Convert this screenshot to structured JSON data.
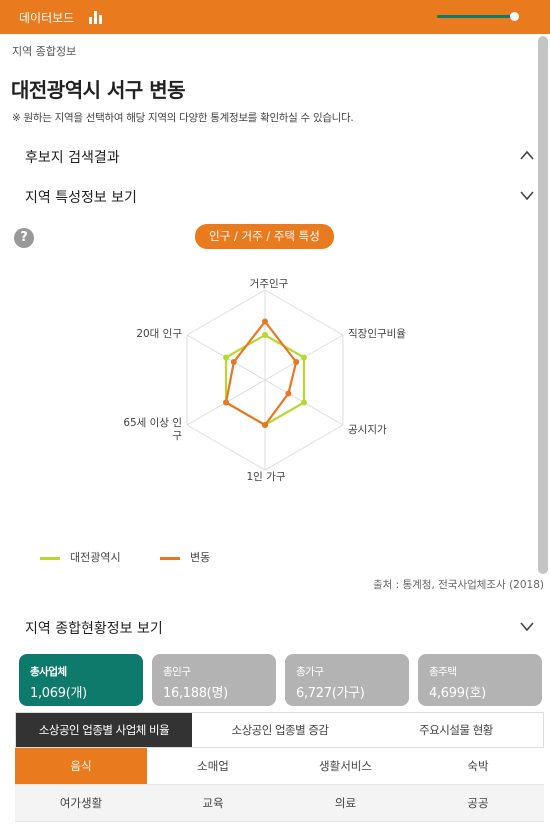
{
  "app": {
    "title": "데이터보드",
    "zoom_level": 0.9
  },
  "breadcrumb": "지역 종합정보",
  "page": {
    "title": "대전광역시 서구 변동",
    "note": "※ 원하는 지역을 선택하여 해당 지역의 다양한 통계정보를 확인하실 수 있습니다."
  },
  "sections": {
    "candidate_results": "후보지 검색결과",
    "region_features": "지역 특성정보 보기",
    "region_summary": "지역 종합현황정보 보기"
  },
  "feature_pill": "인구 / 거주 / 주택 특성",
  "help_label": "?",
  "chart_data": {
    "type": "radar",
    "axes": [
      "거주인구",
      "직장인구비율",
      "공시지가",
      "1인 가구",
      "65세 이상 인구",
      "20대 인구"
    ],
    "scale": [
      0,
      1
    ],
    "series": [
      {
        "name": "대전광역시",
        "color": "#b5d92f",
        "values": [
          0.5,
          0.5,
          0.5,
          0.5,
          0.5,
          0.5
        ]
      },
      {
        "name": "변동",
        "color": "#e87722",
        "values": [
          0.65,
          0.4,
          0.3,
          0.5,
          0.5,
          0.4
        ]
      }
    ]
  },
  "legend": [
    "대전광역시",
    "변동"
  ],
  "source": "출처 : 통계청, 전국사업체조사 (2018)",
  "summary_cards": [
    {
      "label": "총사업체",
      "value": "1,069(개)"
    },
    {
      "label": "총인구",
      "value": "16,188(명)"
    },
    {
      "label": "총가구",
      "value": "6,727(가구)"
    },
    {
      "label": "총주택",
      "value": "4,699(호)"
    }
  ],
  "tabs": [
    "소상공인 업종별 사업체 비율",
    "소상공인 업종별 증감",
    "주요시설물 현황"
  ],
  "categories": [
    "음식",
    "소매업",
    "생활서비스",
    "숙박",
    "여가생활",
    "교육",
    "의료",
    "공공"
  ]
}
